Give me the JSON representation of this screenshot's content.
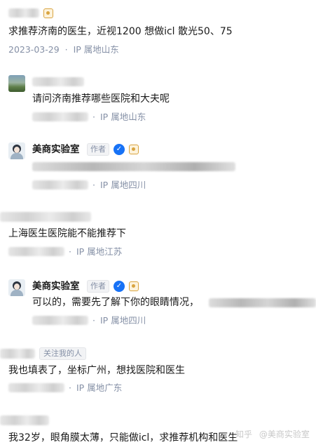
{
  "comments": [
    {
      "content": "求推荐济南的医生，近视1200 想做icl 散光50、75",
      "date": "2023-03-29",
      "ip_location": "IP 属地山东"
    },
    {
      "content": "请问济南推荐哪些医院和大夫呢",
      "ip_location": "IP 属地山东"
    },
    {
      "author": "美商实验室",
      "author_tag": "作者",
      "ip_location": "IP 属地四川"
    },
    {
      "content": "上海医生医院能不能推荐下",
      "ip_location": "IP 属地江苏"
    },
    {
      "author": "美商实验室",
      "author_tag": "作者",
      "content": "可以的，需要先了解下你的眼睛情况，",
      "ip_location": "IP 属地四川"
    },
    {
      "follow_tag": "关注我的人",
      "content": "我也填表了，坐标广州，想找医院和医生",
      "ip_location": "IP 属地广东"
    },
    {
      "content": "我32岁，眼角膜太薄，只能做icl，求推荐机构和医生"
    }
  ],
  "separator": "·",
  "watermark": {
    "left": "知乎",
    "right": "@美商实验室"
  },
  "colors": {
    "meta_gray": "#8590a6",
    "verified_blue": "#1772f6",
    "badge_gold": "#d9a441"
  },
  "icons": [
    "verified-icon",
    "gold-level-icon"
  ]
}
